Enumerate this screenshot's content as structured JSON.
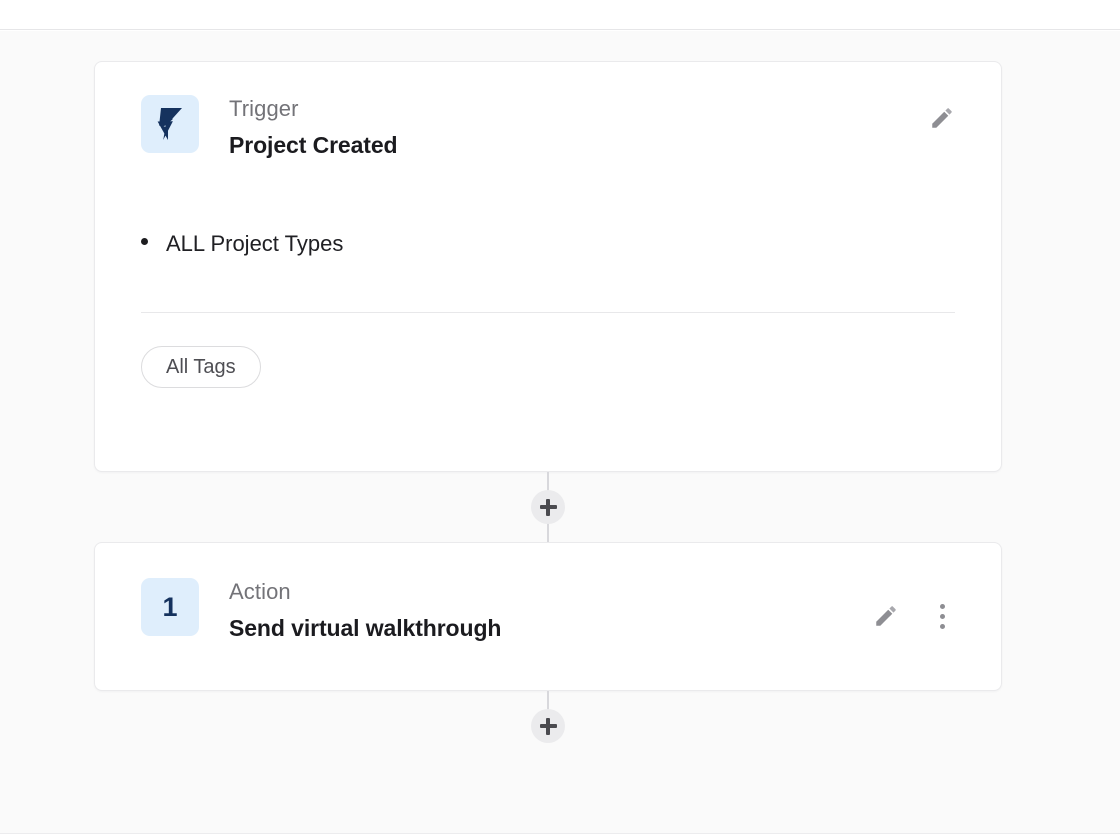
{
  "theme": {
    "page_background": "#ffffff",
    "canvas_background": "#fafafa",
    "card_background": "#ffffff",
    "card_border": "#eaeaec",
    "badge_background": "#dfeefc",
    "badge_foreground": "#15325e",
    "muted_text": "#737378",
    "primary_text": "#1b1b1f",
    "icon_gray": "#8e8e93",
    "connector_gray": "#d8d8dc",
    "plus_button_background": "#ebebed"
  },
  "workflow": {
    "nodes": [
      {
        "type": "trigger",
        "kicker": "Trigger",
        "title": "Project Created",
        "badge_icon": "lightning-bolt-icon",
        "conditions": [
          "ALL Project Types"
        ],
        "tags": [
          "All Tags"
        ],
        "edit_icon": "pencil-icon"
      },
      {
        "type": "action",
        "kicker": "Action",
        "title": "Send virtual walkthrough",
        "badge_number": "1",
        "edit_icon": "pencil-icon",
        "menu_icon": "more-vertical-icon"
      }
    ],
    "connectors": [
      {
        "label": "+",
        "name": "add-step-after-trigger"
      },
      {
        "label": "+",
        "name": "add-step-after-action-1"
      }
    ]
  }
}
